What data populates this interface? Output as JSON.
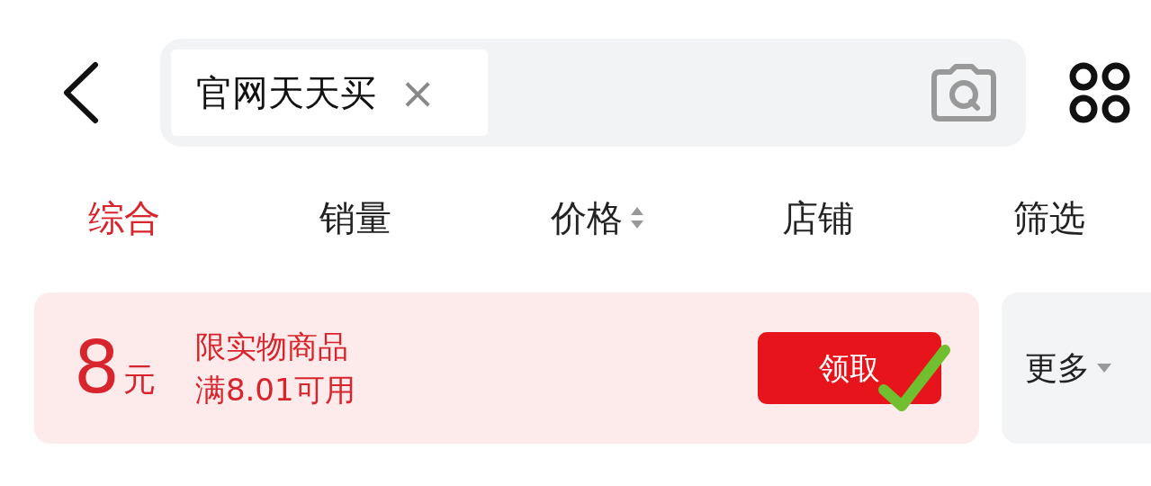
{
  "search": {
    "query": "官网天天买",
    "clear": "×"
  },
  "tabs": [
    {
      "label": "综合",
      "selected": true,
      "sortable": false
    },
    {
      "label": "销量",
      "selected": false,
      "sortable": false
    },
    {
      "label": "价格",
      "selected": false,
      "sortable": true
    },
    {
      "label": "店铺",
      "selected": false,
      "sortable": false
    },
    {
      "label": "筛选",
      "selected": false,
      "sortable": false
    }
  ],
  "coupon": {
    "amount": "8",
    "unit": "元",
    "lines": [
      "限实物商品",
      "满8.01可用"
    ],
    "button": "领取",
    "claimed": true
  },
  "more": {
    "label": "更多"
  }
}
